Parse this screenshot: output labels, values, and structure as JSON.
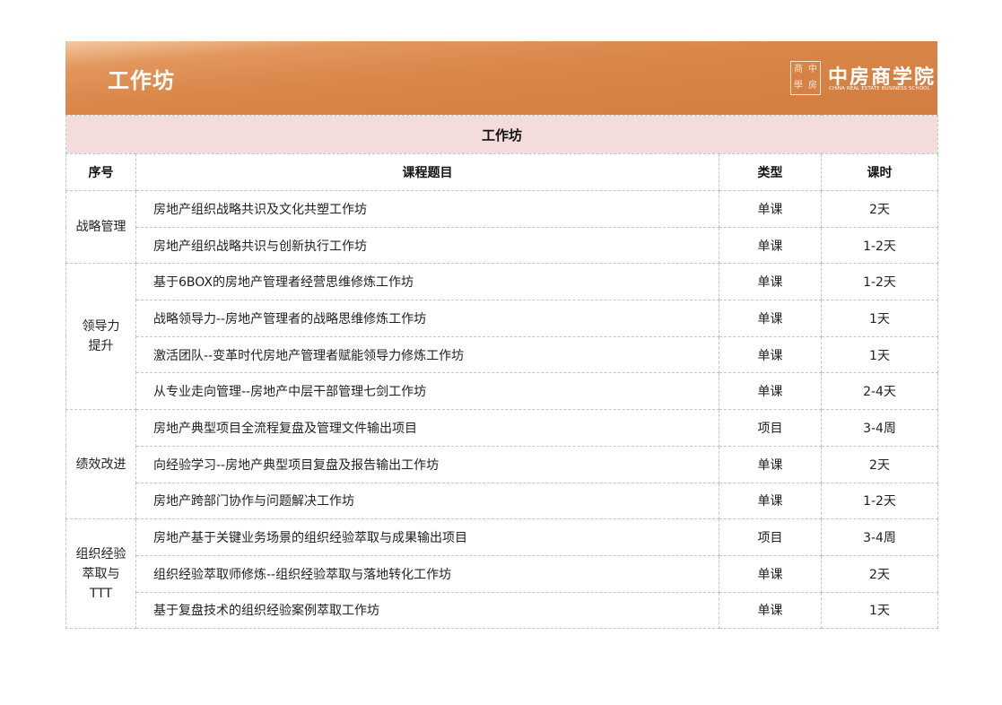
{
  "header": {
    "title": "工作坊",
    "logo_seal_chars": [
      "商",
      "中",
      "學",
      "房"
    ],
    "logo_name_cn": "中房商学院",
    "logo_name_en": "CHINA REAL ESTATE BUSINESS SCHOOL"
  },
  "table": {
    "caption": "工作坊",
    "columns": [
      "序号",
      "课程题目",
      "类型",
      "课时"
    ],
    "groups": [
      {
        "category": "战略管理",
        "rows": [
          {
            "topic": "房地产组织战略共识及文化共塑工作坊",
            "type": "单课",
            "hours": "2天"
          },
          {
            "topic": "房地产组织战略共识与创新执行工作坊",
            "type": "单课",
            "hours": "1-2天"
          }
        ]
      },
      {
        "category": "领导力\n提升",
        "rows": [
          {
            "topic": "基于6BOX的房地产管理者经营思维修炼工作坊",
            "type": "单课",
            "hours": "1-2天"
          },
          {
            "topic": "战略领导力--房地产管理者的战略思维修炼工作坊",
            "type": "单课",
            "hours": "1天"
          },
          {
            "topic": "激活团队--变革时代房地产管理者赋能领导力修炼工作坊",
            "type": "单课",
            "hours": "1天"
          },
          {
            "topic": "从专业走向管理--房地产中层干部管理七剑工作坊",
            "type": "单课",
            "hours": "2-4天"
          }
        ]
      },
      {
        "category": "绩效改进",
        "rows": [
          {
            "topic": "房地产典型项目全流程复盘及管理文件输出项目",
            "type": "项目",
            "hours": "3-4周"
          },
          {
            "topic": "向经验学习--房地产典型项目复盘及报告输出工作坊",
            "type": "单课",
            "hours": "2天"
          },
          {
            "topic": "房地产跨部门协作与问题解决工作坊",
            "type": "单课",
            "hours": "1-2天"
          }
        ]
      },
      {
        "category": "组织经验\n萃取与\nTTT",
        "rows": [
          {
            "topic": "房地产基于关键业务场景的组织经验萃取与成果输出项目",
            "type": "项目",
            "hours": "3-4周"
          },
          {
            "topic": "组织经验萃取师修炼--组织经验萃取与落地转化工作坊",
            "type": "单课",
            "hours": "2天"
          },
          {
            "topic": "基于复盘技术的组织经验案例萃取工作坊",
            "type": "单课",
            "hours": "1天"
          }
        ]
      }
    ]
  }
}
